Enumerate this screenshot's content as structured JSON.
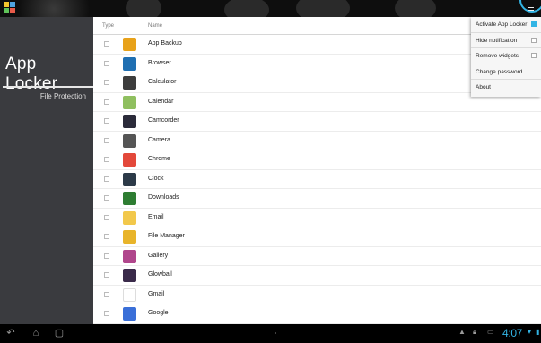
{
  "sidebar": {
    "title": "App Locker",
    "items": [
      {
        "label": "File Protection"
      }
    ]
  },
  "table": {
    "columns": {
      "type": "Type",
      "name": "Name"
    },
    "rows": [
      {
        "name": "App Backup",
        "icon": "app-backup-icon",
        "color": "#e8a21a"
      },
      {
        "name": "Browser",
        "icon": "browser-icon",
        "color": "#1f6fb2"
      },
      {
        "name": "Calculator",
        "icon": "calculator-icon",
        "color": "#3d3d3d"
      },
      {
        "name": "Calendar",
        "icon": "calendar-icon",
        "color": "#8fbf5f"
      },
      {
        "name": "Camcorder",
        "icon": "camcorder-icon",
        "color": "#2b2b3a"
      },
      {
        "name": "Camera",
        "icon": "camera-icon",
        "color": "#555555"
      },
      {
        "name": "Chrome",
        "icon": "chrome-icon",
        "color": "#e3483a"
      },
      {
        "name": "Clock",
        "icon": "clock-icon",
        "color": "#2c3a48"
      },
      {
        "name": "Downloads",
        "icon": "downloads-icon",
        "color": "#2e7d32"
      },
      {
        "name": "Email",
        "icon": "email-icon",
        "color": "#f2c84b"
      },
      {
        "name": "File Manager",
        "icon": "file-manager-icon",
        "color": "#e8b42a"
      },
      {
        "name": "Gallery",
        "icon": "gallery-icon",
        "color": "#b0468c"
      },
      {
        "name": "Glowball",
        "icon": "glowball-icon",
        "color": "#3a2a4a"
      },
      {
        "name": "Gmail",
        "icon": "gmail-icon",
        "color": "#ffffff"
      },
      {
        "name": "Google",
        "icon": "google-icon",
        "color": "#3a6fd8"
      }
    ]
  },
  "menu": {
    "items": [
      {
        "label": "Activate App Locker",
        "has_check": true,
        "checked": true
      },
      {
        "label": "Hide notification",
        "has_check": true,
        "checked": false
      },
      {
        "label": "Remove widgets",
        "has_check": true,
        "checked": false
      },
      {
        "label": "Change password",
        "has_check": false
      },
      {
        "label": "About",
        "has_check": false
      }
    ]
  },
  "status_bar": {
    "time": "4:07"
  },
  "colors": {
    "accent": "#33b5e5",
    "sidebar_bg": "#3a3b3f"
  }
}
